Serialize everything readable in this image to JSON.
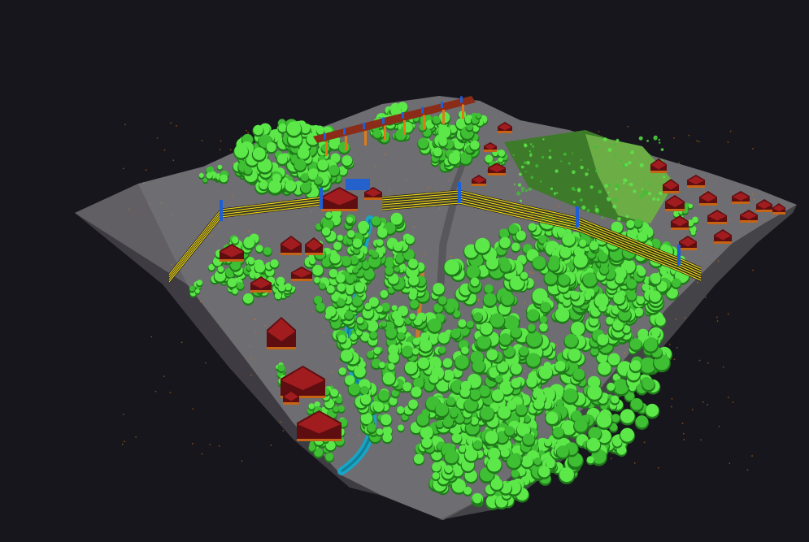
{
  "scene": {
    "type": "classified-lidar-point-cloud",
    "view": "oblique-perspective",
    "colors": {
      "background": "#17161c",
      "ground": "#6e6d71",
      "ground_dark": "#58575b",
      "vegetation": "#5de84a",
      "vegetation_dark": "#1f7a1a",
      "vegetation_mid": "#3fbf33",
      "building": "#a01c1f",
      "building_dark": "#5e0d10",
      "low_point": "#e07a18",
      "water": "#18a4c4",
      "power_line": "#e8d21c",
      "structure": "#1c5fd6"
    },
    "classes": [
      "ground",
      "vegetation",
      "building",
      "low-point",
      "water",
      "power-line",
      "structure"
    ]
  }
}
